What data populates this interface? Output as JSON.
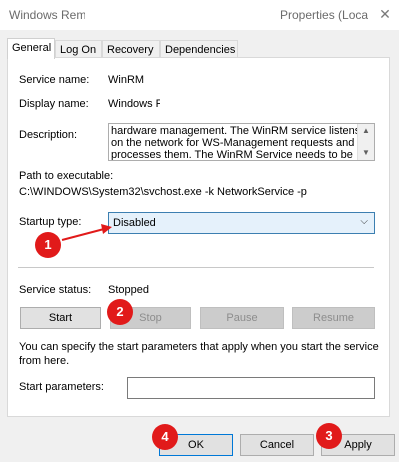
{
  "window": {
    "title_left": "Windows Remote Management (WS-Management)",
    "title_right": "Properties (Local Computer)",
    "close_glyph": "✕"
  },
  "tabs": [
    {
      "label": "General"
    },
    {
      "label": "Log On"
    },
    {
      "label": "Recovery"
    },
    {
      "label": "Dependencies"
    }
  ],
  "general": {
    "service_name_label": "Service name:",
    "service_name_value": "WinRM",
    "display_name_label": "Display name:",
    "display_name_value": "Windows Remote Management (WS-Management)",
    "description_label": "Description:",
    "description_lines": [
      "hardware management. The WinRM service listens",
      "on the network for WS-Management requests and",
      "processes them. The WinRM Service needs to be"
    ],
    "path_label": "Path to executable:",
    "path_value": "C:\\WINDOWS\\System32\\svchost.exe -k NetworkService -p",
    "startup_label": "Startup type:",
    "startup_value": "Disabled",
    "status_label": "Service status:",
    "status_value": "Stopped",
    "start_button": "Start",
    "stop_button": "Stop",
    "pause_button": "Pause",
    "resume_button": "Resume",
    "hint_line1": "You can specify the start parameters that apply when you start the service",
    "hint_line2": "from here.",
    "params_label": "Start parameters:",
    "params_value": ""
  },
  "footer": {
    "ok_button": "OK",
    "cancel_button": "Cancel",
    "apply_button": "Apply"
  },
  "annotations": [
    "1",
    "2",
    "3",
    "4"
  ],
  "colors": {
    "annotation_red": "#e11a1a",
    "focus_blue": "#0078d7",
    "dialog_bg": "#f0f0f0"
  }
}
